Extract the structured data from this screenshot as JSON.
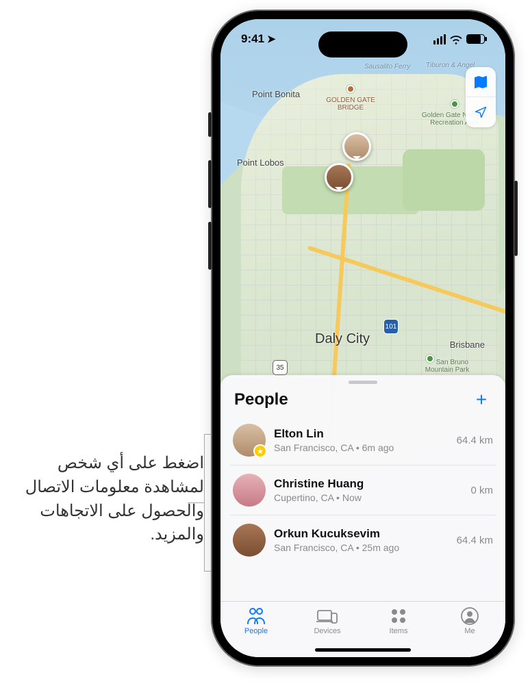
{
  "status": {
    "time": "9:41"
  },
  "map": {
    "labels": {
      "point_bonita": "Point Bonita",
      "golden_gate_bridge": "GOLDEN GATE BRIDGE",
      "golden_gate_rec": "Golden Gate National Recreation Area",
      "point_lobos": "Point Lobos",
      "daly_city": "Daly City",
      "brisbane": "Brisbane",
      "san_bruno_park": "San Bruno Mountain Park",
      "ferry1": "Sausalito Ferry",
      "ferry2": "Tiburon & Angel",
      "shield_35": "35",
      "shield_101": "101"
    }
  },
  "sheet": {
    "title": "People"
  },
  "people": [
    {
      "name": "Elton Lin",
      "location": "San Francisco, CA",
      "sep": " • ",
      "when": "6m ago",
      "distance": "64.4 km",
      "fav": true
    },
    {
      "name": "Christine Huang",
      "location": "Cupertino, CA",
      "sep": " • ",
      "when": "Now",
      "distance": "0 km",
      "fav": false
    },
    {
      "name": "Orkun Kucuksevim",
      "location": "San Francisco, CA",
      "sep": " • ",
      "when": "25m ago",
      "distance": "64.4 km",
      "fav": false
    }
  ],
  "tabs": {
    "people": "People",
    "devices": "Devices",
    "items": "Items",
    "me": "Me"
  },
  "callout": "اضغط على أي شخص لمشاهدة معلومات الاتصال والحصول على الاتجاهات والمزيد."
}
